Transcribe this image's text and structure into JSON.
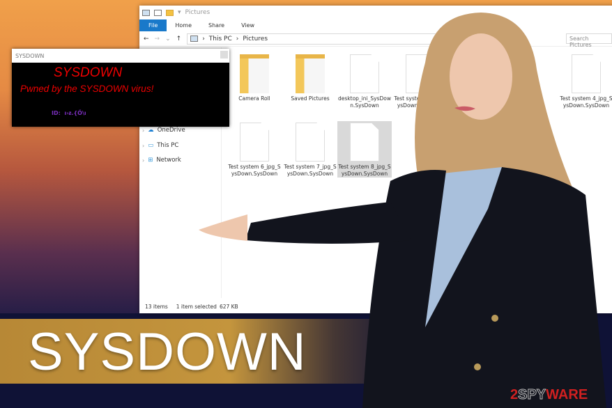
{
  "explorer": {
    "title": "Pictures",
    "ribbon": [
      "File",
      "Home",
      "Share",
      "View"
    ],
    "breadcrumb": [
      "This PC",
      "Pictures"
    ],
    "search_placeholder": "Search Pictures",
    "nav": [
      "OneDrive",
      "This PC",
      "Network"
    ],
    "items": [
      {
        "label": "Camera Roll",
        "type": "folder"
      },
      {
        "label": "Saved Pictures",
        "type": "folder"
      },
      {
        "label": "desktop_ini_SysDown.SysDown",
        "type": "file"
      },
      {
        "label": "Test system 1_jpg_SysDown.SysDown",
        "type": "file"
      },
      {
        "label": "Test system 4_jpg_SysDown.SysDown",
        "type": "file"
      },
      {
        "label": "Test system 6_jpg_SysDown.SysDown",
        "type": "file"
      },
      {
        "label": "Test system 7_jpg_SysDown.SysDown",
        "type": "file"
      },
      {
        "label": "Test system 8_jpg_SysDown.SysDown",
        "type": "file",
        "selected": true
      }
    ],
    "status": {
      "count": "13 items",
      "selected": "1 item selected",
      "size": "627 KB"
    }
  },
  "popup": {
    "window_title": "SYSDOWN",
    "heading": "SYSDOWN",
    "message": "Pwned by the SYSDOWN virus!",
    "id_label": "ID:",
    "id_value": "ı›ᵶ.{Ő\\ı"
  },
  "banner": {
    "title": "SYSDOWN"
  },
  "logo": {
    "text": "2SPYWARE"
  },
  "colors": {
    "accent": "#1979ca",
    "ransom_text": "#e00000",
    "id_text": "#7b2fbf",
    "banner": "#c4953d"
  }
}
